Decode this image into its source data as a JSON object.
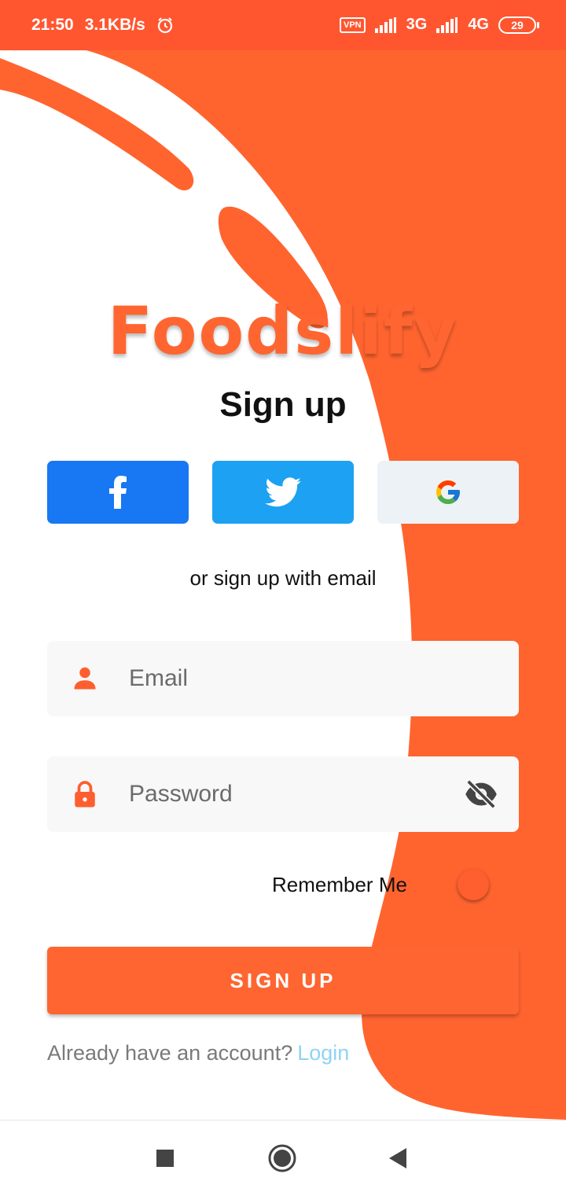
{
  "status_bar": {
    "time": "21:50",
    "net_speed": "3.1KB/s",
    "vpn": "VPN",
    "network_1": "3G",
    "network_2": "4G",
    "battery": "29"
  },
  "app": {
    "logo": "Foodslify",
    "title": "Sign up"
  },
  "social": {
    "facebook": "f-icon",
    "twitter": "bird-icon",
    "google": "g-icon"
  },
  "form": {
    "or_text": "or sign up with email",
    "email_placeholder": "Email",
    "password_placeholder": "Password",
    "remember_label": "Remember Me",
    "signup_label": "SIGN UP"
  },
  "footer": {
    "prompt": "Already have an account?",
    "login_label": "Login"
  },
  "colors": {
    "brand": "#ff6530",
    "status_bar": "#ff5630",
    "facebook": "#1877f2",
    "twitter": "#1da1f2",
    "google_bg": "#edf2f7"
  }
}
